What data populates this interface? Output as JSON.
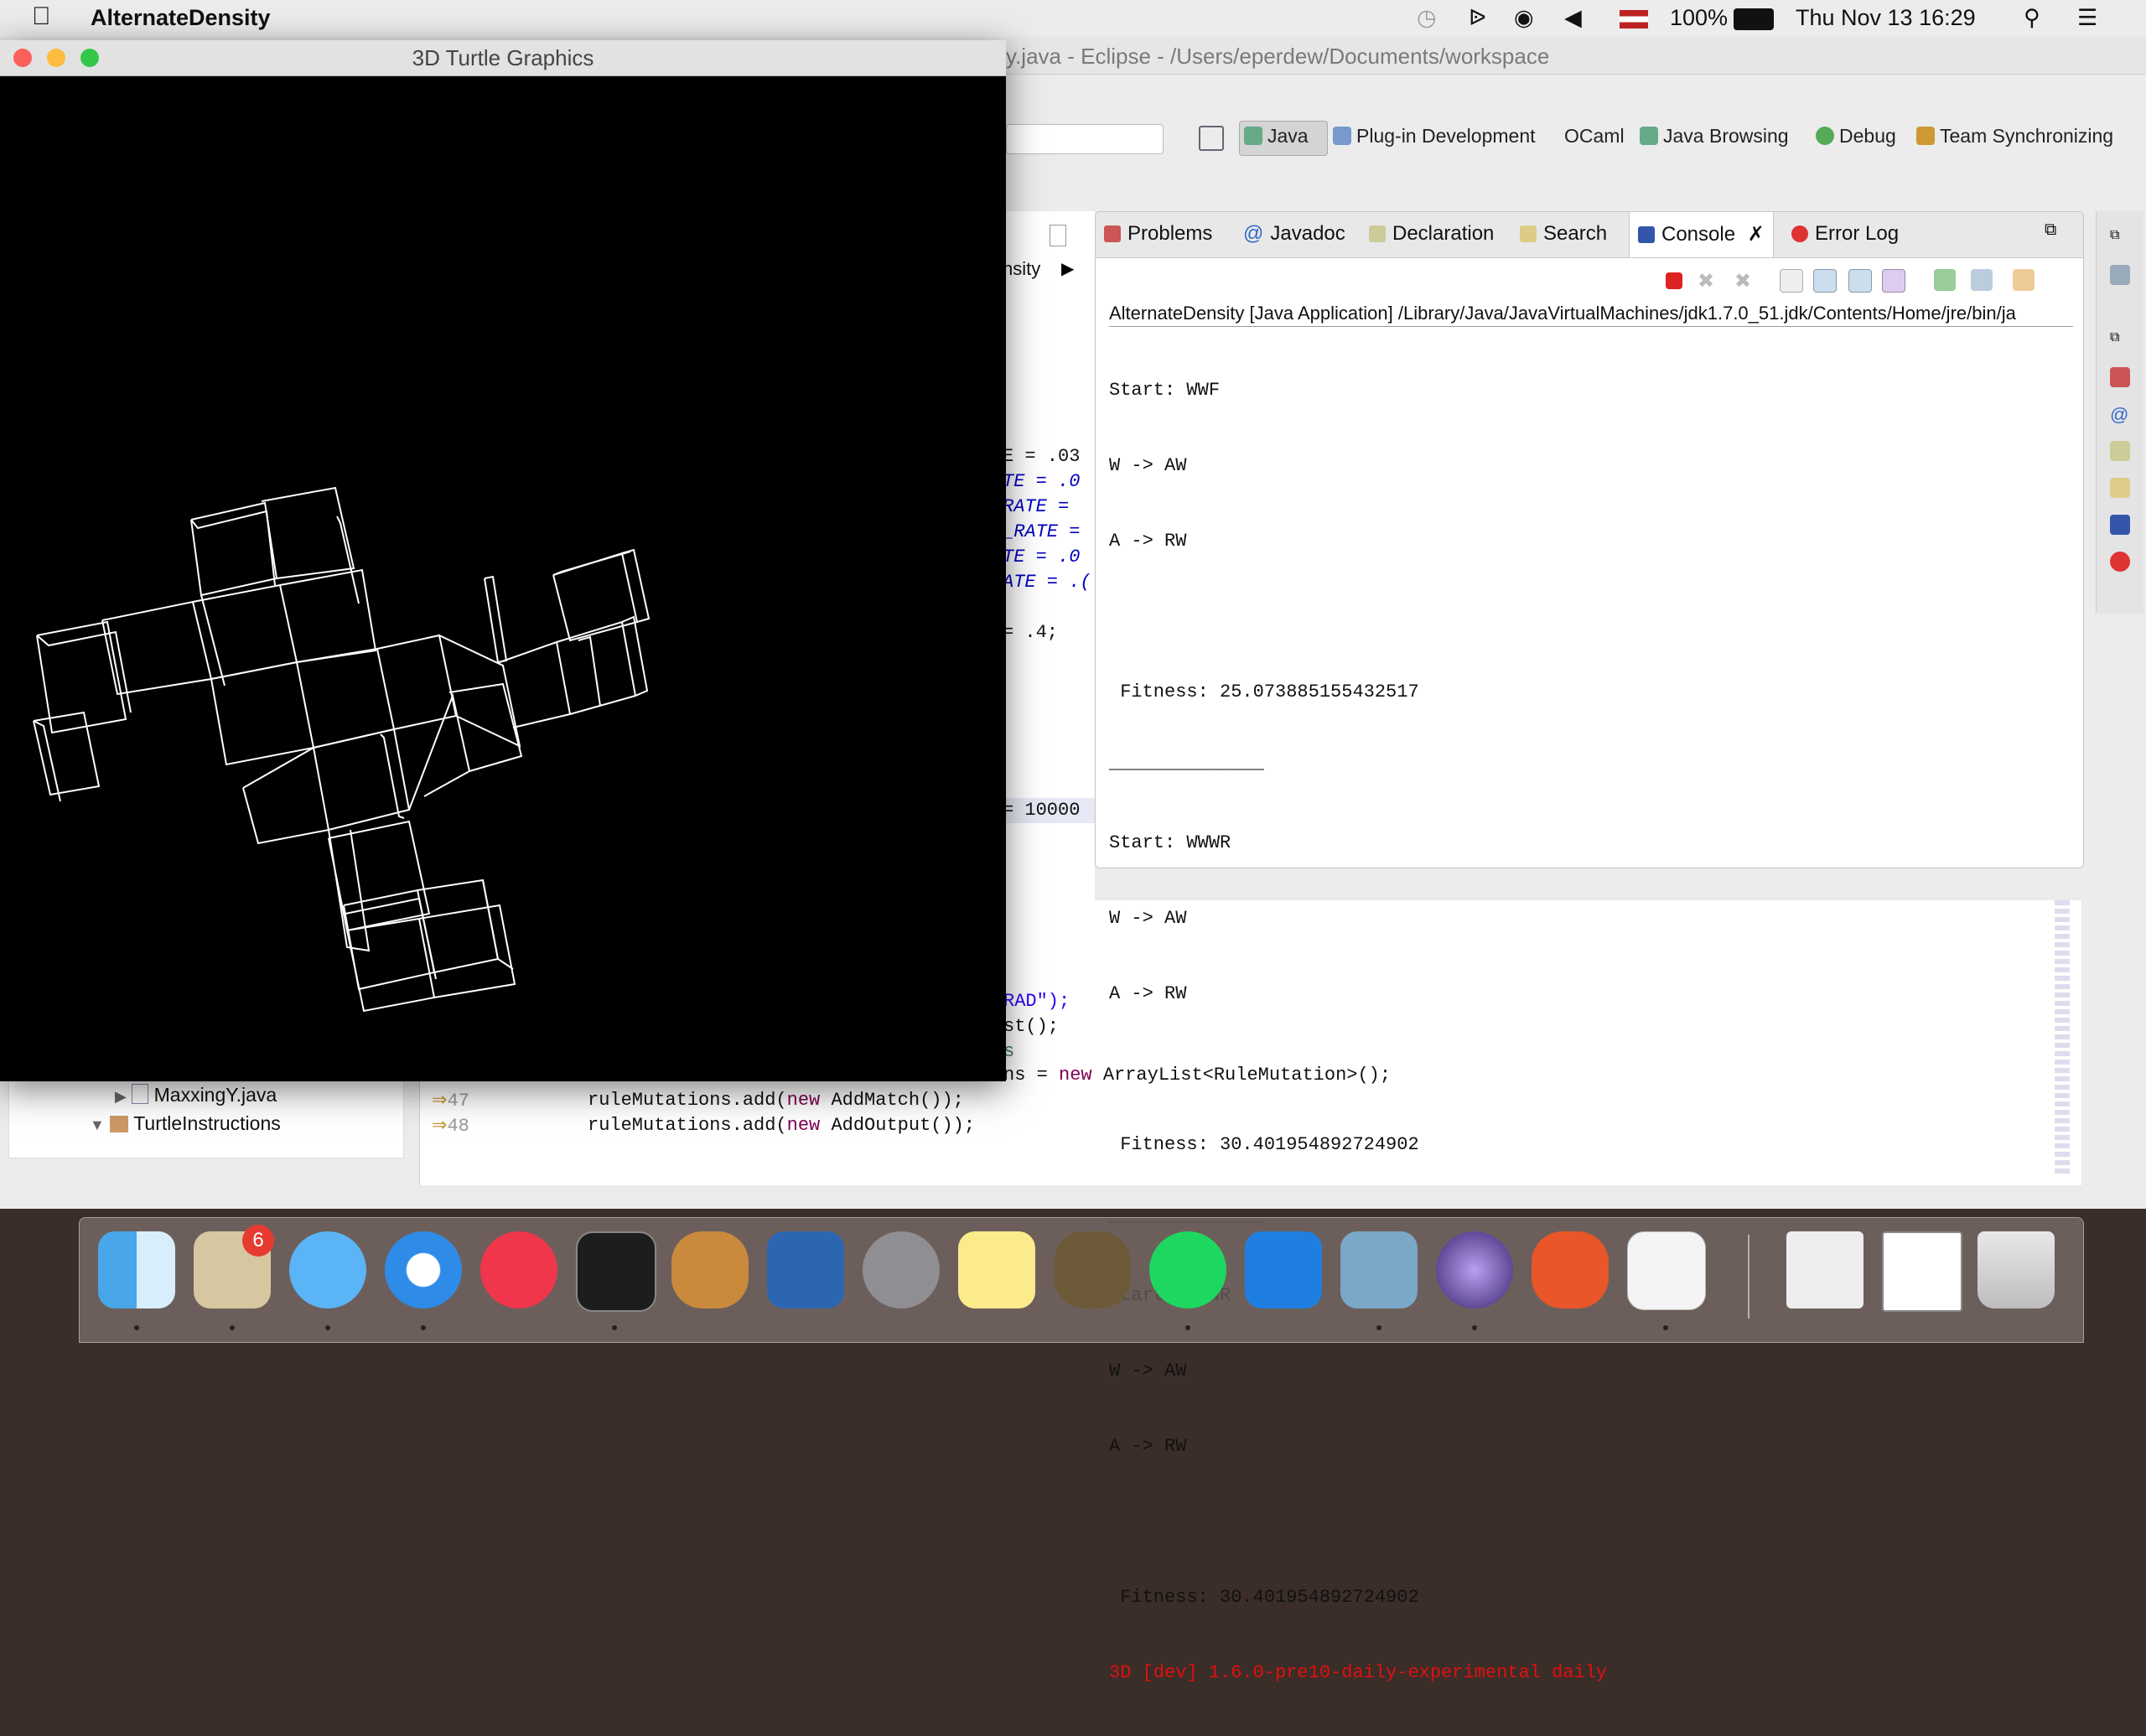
{
  "menubar": {
    "app_name": "AlternateDensity",
    "battery": "100%",
    "datetime": "Thu Nov 13  16:29"
  },
  "eclipse": {
    "title": "y.java - Eclipse - /Users/eperdew/Documents/workspace",
    "perspectives": [
      "Java",
      "Plug-in Development",
      "OCaml",
      "Java Browsing",
      "Debug",
      "Team Synchronizing"
    ],
    "breadcrumb_fragment": "nsity"
  },
  "views": {
    "tabs": [
      "Problems",
      "Javadoc",
      "Declaration",
      "Search",
      "Console",
      "Error Log"
    ],
    "active_tab": "Console"
  },
  "console": {
    "header": "AlternateDensity [Java Application] /Library/Java/JavaVirtualMachines/jdk1.7.0_51.jdk/Contents/Home/jre/bin/ja",
    "lines": [
      "Start: WWF",
      "W -> AW",
      "A -> RW",
      "",
      " Fitness: 25.073885155432517",
      "______________",
      "Start: WWWR",
      "W -> AW",
      "A -> RW",
      "",
      " Fitness: 30.401954892724902",
      "______________",
      "Start: WWWR",
      "W -> AW",
      "A -> RW",
      "",
      " Fitness: 30.401954892724902"
    ],
    "error_line": "3D [dev] 1.6.0-pre10-daily-experimental daily"
  },
  "editor": {
    "frag_lines": [
      "E = .03",
      "TE = .0",
      "RATE =",
      "_RATE =",
      "TE = .0",
      "ATE = .(",
      "= .4;",
      "= 10000"
    ],
    "frag_lower": [
      "RAD\");",
      "st();",
      "s"
    ],
    "line47_num": "47",
    "line48_num": "48",
    "line46_tail": "ArrayList<RuleMutation>();",
    "line46_new": "new",
    "line46_eq": "ns = ",
    "line47_pre": "ruleMutations.add(",
    "line47_new": "new",
    "line47_post": " AddMatch());",
    "line48_pre": "ruleMutations.add(",
    "line48_new": "new",
    "line48_post": " AddOutput());"
  },
  "package_explorer": {
    "items": [
      "MaxxingY.java",
      "TurtleInstructions"
    ]
  },
  "turtle_window": {
    "title": "3D Turtle Graphics"
  },
  "dock": {
    "mail_badge": "6",
    "icons": [
      "finder-icon",
      "mail-icon",
      "messages-icon",
      "safari-icon",
      "itunes-icon",
      "terminal-icon",
      "gimp-icon",
      "virtualbox-icon",
      "system-preferences-icon",
      "notes-icon",
      "cauldron-icon",
      "spotify-icon",
      "xcode-icon",
      "preview-icon",
      "eclipse-icon",
      "powerpoint-icon",
      "java-icon",
      "zip-icon",
      "screenshot-icon",
      "trash-icon"
    ]
  }
}
